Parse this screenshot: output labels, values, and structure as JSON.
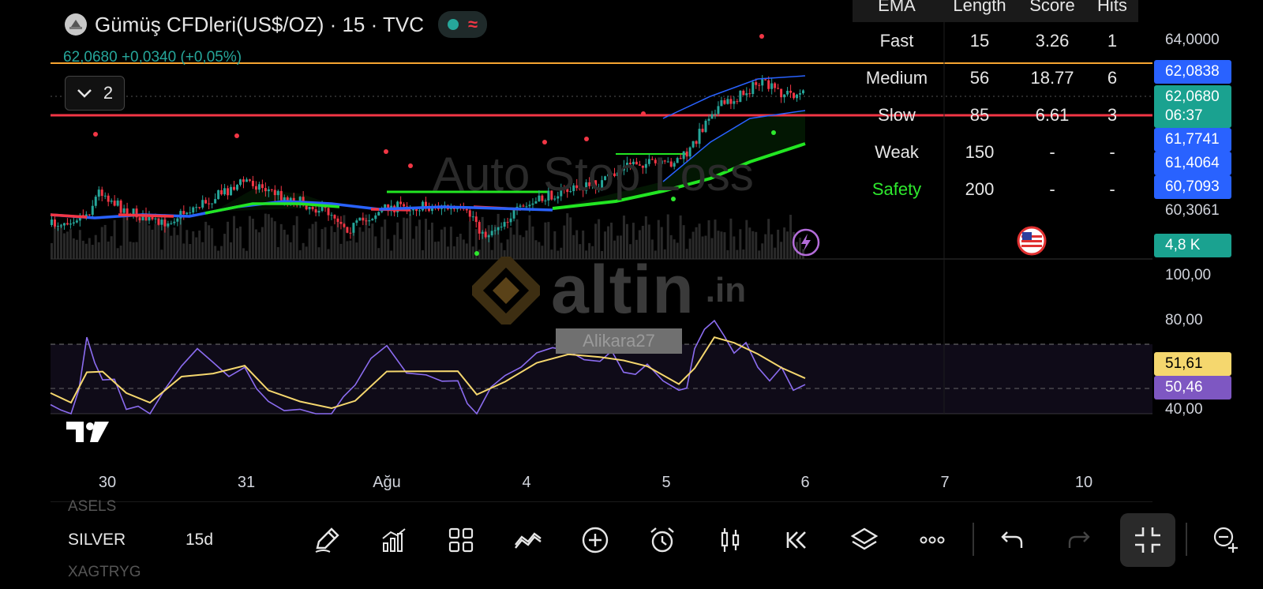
{
  "header": {
    "symbol_title": "Gümüş CFDleri(US$/OZ) · 15 · TVC",
    "price_change": "62,0680  +0,0340 (+0,05%)",
    "collapse_count": "2"
  },
  "ema_table": {
    "headers": [
      "EMA",
      "Length",
      "Score",
      "Hits"
    ],
    "rows": [
      {
        "name": "Fast",
        "length": "15",
        "score": "3.26",
        "hits": "1",
        "color": "#e6e6e6"
      },
      {
        "name": "Medium",
        "length": "56",
        "score": "18.77",
        "hits": "6",
        "color": "#e6e6e6"
      },
      {
        "name": "Slow",
        "length": "85",
        "score": "6.61",
        "hits": "3",
        "color": "#e6e6e6"
      },
      {
        "name": "Weak",
        "length": "150",
        "score": "-",
        "hits": "-",
        "color": "#e6e6e6"
      },
      {
        "name": "Safety",
        "length": "200",
        "score": "-",
        "hits": "-",
        "color": "#2ee82e"
      }
    ]
  },
  "price_axis": {
    "label_top": "64,0000",
    "label_low": "60,3061",
    "tag_1": "62,0838",
    "tag_current": "62,0680",
    "countdown": "06:37",
    "tag_2": "61,7741",
    "tag_3": "61,4064",
    "tag_4": "60,7093",
    "volume_tag": "4,8 K"
  },
  "osc_axis": {
    "label_100": "100,00",
    "label_80": "80,00",
    "label_40": "40,00",
    "tag_yellow": "51,61",
    "tag_purple": "50,46"
  },
  "dates": [
    "30",
    "31",
    "Ağu",
    "4",
    "5",
    "6",
    "7",
    "10"
  ],
  "watermarks": {
    "indicator": "Auto Stop Loss",
    "brand": "altin",
    "brand_suffix": ".in",
    "user": "Alikara27"
  },
  "bottom": {
    "ghost_above": "ASELS",
    "symbol": "SILVER",
    "interval": "15d",
    "ghost_below": "XAGTRYG"
  },
  "toolbar": [
    "pencil-icon",
    "chart-bars-icon",
    "grid-icon",
    "indicators-icon",
    "plus-circle-icon",
    "alarm-icon",
    "candles-icon",
    "rewind-icon",
    "layers-icon",
    "more-icon",
    "undo-icon",
    "redo-icon",
    "fullscreen-exit-icon",
    "crosshair-icon"
  ],
  "colors": {
    "up": "#26a69a",
    "down": "#f23645",
    "ema_green": "#22e622",
    "ema_blue": "#2962ff",
    "rsi": "#8b6cf0",
    "signal": "#f5d76e",
    "orange_line": "#f7a531",
    "red_line": "#f23645",
    "tag_blue": "#2962ff",
    "tag_teal": "#1aa290",
    "tag_yellow": "#f5d76e",
    "tag_purple": "#7e57c2"
  }
}
